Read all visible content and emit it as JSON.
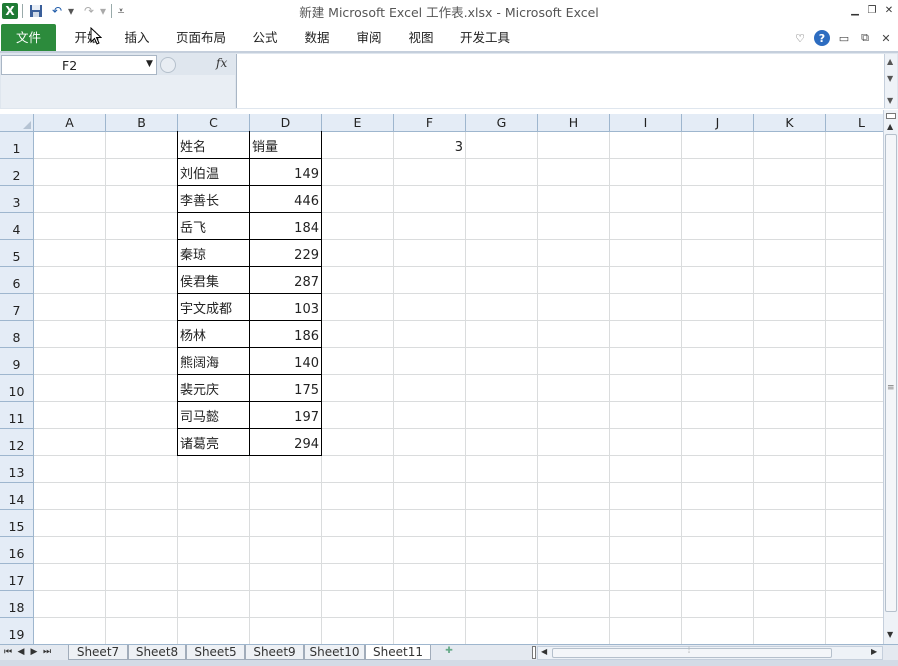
{
  "window": {
    "title": "新建 Microsoft Excel 工作表.xlsx  -  Microsoft Excel",
    "logo_letter": "X"
  },
  "icons": {
    "logo": "excel-logo-icon",
    "save": "save-icon",
    "undo": "undo-icon",
    "redo": "redo-icon",
    "customize": "qat-dropdown-icon",
    "help": "help-icon",
    "function": "fx-icon"
  },
  "ribbon": {
    "tabs": [
      "文件",
      "开始",
      "插入",
      "页面布局",
      "公式",
      "数据",
      "审阅",
      "视图",
      "开发工具"
    ],
    "help_label": "?"
  },
  "formula_bar": {
    "name_box": "F2",
    "fx_label": "fx",
    "formula": ""
  },
  "grid": {
    "columns": [
      "A",
      "B",
      "C",
      "D",
      "E",
      "F",
      "G",
      "H",
      "I",
      "J",
      "K",
      "L"
    ],
    "rows": [
      "1",
      "2",
      "3",
      "4",
      "5",
      "6",
      "7",
      "8",
      "9",
      "10",
      "11",
      "12",
      "13",
      "14",
      "15",
      "16",
      "17",
      "18",
      "19"
    ],
    "table": {
      "header": {
        "name": "姓名",
        "sales": "销量"
      },
      "records": [
        {
          "name": "刘伯温",
          "sales": "149"
        },
        {
          "name": "李善长",
          "sales": "446"
        },
        {
          "name": "岳飞",
          "sales": "184"
        },
        {
          "name": "秦琼",
          "sales": "229"
        },
        {
          "name": "侯君集",
          "sales": "287"
        },
        {
          "name": "宇文成都",
          "sales": "103"
        },
        {
          "name": "杨林",
          "sales": "186"
        },
        {
          "name": "熊阔海",
          "sales": "140"
        },
        {
          "name": "裴元庆",
          "sales": "175"
        },
        {
          "name": "司马懿",
          "sales": "197"
        },
        {
          "name": "诸葛亮",
          "sales": "294"
        }
      ]
    },
    "cell_f1": "3"
  },
  "sheets": {
    "tabs": [
      "Sheet7",
      "Sheet8",
      "Sheet5",
      "Sheet9",
      "Sheet10",
      "Sheet11"
    ],
    "active": "Sheet11"
  },
  "colors": {
    "file_tab": "#2c8b3c",
    "header_bg": "#e4ecf6",
    "gridline": "#dadcdd"
  }
}
